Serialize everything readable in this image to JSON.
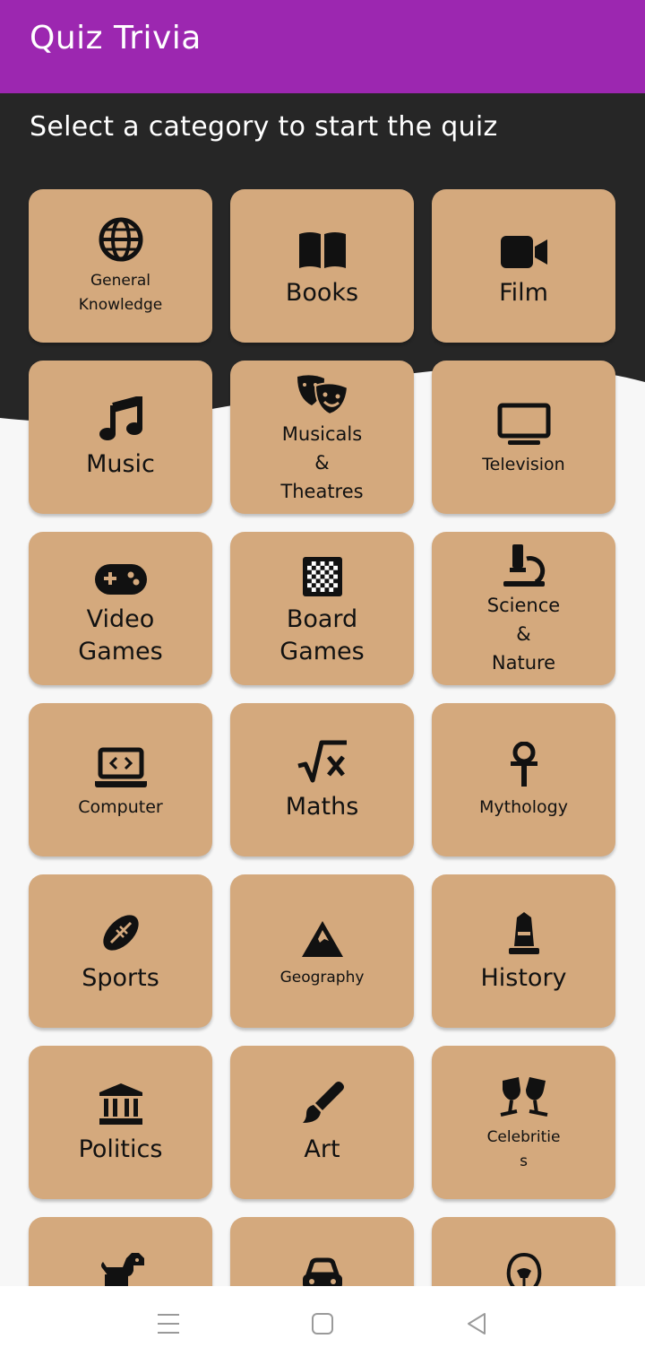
{
  "app": {
    "title": "Quiz Trivia"
  },
  "page": {
    "subtitle": "Select a category to start the quiz"
  },
  "colors": {
    "app_bar": "#9c27b0",
    "dark_background": "#262626",
    "tile": "#d4a97d",
    "page_background": "#f7f7f7"
  },
  "categories": [
    {
      "label": "General\nKnowledge",
      "icon": "globe-icon"
    },
    {
      "label": "Books",
      "icon": "book-open-icon"
    },
    {
      "label": "Film",
      "icon": "video-camera-icon"
    },
    {
      "label": "Music",
      "icon": "music-note-icon"
    },
    {
      "label": "Musicals\n&\nTheatres",
      "icon": "theater-masks-icon"
    },
    {
      "label": "Television",
      "icon": "tv-icon"
    },
    {
      "label": "Video\nGames",
      "icon": "gamepad-icon"
    },
    {
      "label": "Board\nGames",
      "icon": "chessboard-icon"
    },
    {
      "label": "Science\n&\nNature",
      "icon": "microscope-icon"
    },
    {
      "label": "Computer",
      "icon": "laptop-code-icon"
    },
    {
      "label": "Maths",
      "icon": "square-root-icon"
    },
    {
      "label": "Mythology",
      "icon": "ankh-icon"
    },
    {
      "label": "Sports",
      "icon": "football-icon"
    },
    {
      "label": "Geography",
      "icon": "mountain-icon"
    },
    {
      "label": "History",
      "icon": "monument-icon"
    },
    {
      "label": "Politics",
      "icon": "landmark-icon"
    },
    {
      "label": "Art",
      "icon": "paintbrush-icon"
    },
    {
      "label": "Celebritie\ns",
      "icon": "glass-cheers-icon"
    },
    {
      "label": "",
      "icon": "dog-icon"
    },
    {
      "label": "",
      "icon": "car-icon"
    },
    {
      "label": "",
      "icon": "mandalorian-icon"
    }
  ],
  "nav": {
    "menu": "menu-icon",
    "home": "home-icon",
    "back": "back-icon"
  }
}
